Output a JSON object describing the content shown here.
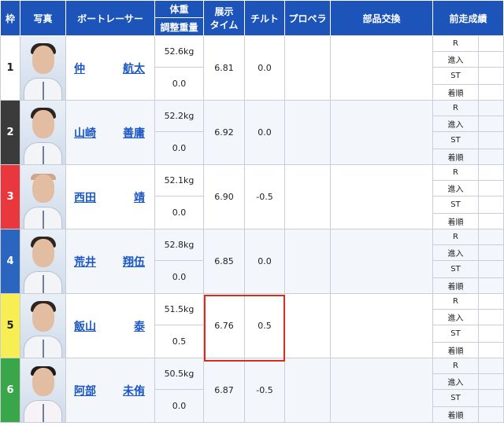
{
  "headers": {
    "lane": "枠",
    "photo": "写真",
    "racer": "ボートレーサー",
    "weight": "体重",
    "adjust_weight": "調整重量",
    "exhibit_time_line1": "展示",
    "exhibit_time_line2": "タイム",
    "tilt": "チルト",
    "propeller": "プロペラ",
    "parts": "部品交換",
    "prev_results": "前走成績"
  },
  "record_labels": [
    "R",
    "進入",
    "ST",
    "着順"
  ],
  "lane_colors": {
    "1": "#ffffff",
    "2": "#3b3b3b",
    "3": "#e8373d",
    "4": "#2a66bf",
    "5": "#f6ee53",
    "6": "#3aa64a"
  },
  "racers": [
    {
      "lane": "1",
      "surname": "仲",
      "given": "航太",
      "weight": "52.6kg",
      "adjust": "0.0",
      "exhibit_time": "6.81",
      "tilt": "0.0"
    },
    {
      "lane": "2",
      "surname": "山崎",
      "given": "善庸",
      "weight": "52.2kg",
      "adjust": "0.0",
      "exhibit_time": "6.92",
      "tilt": "0.0"
    },
    {
      "lane": "3",
      "surname": "西田",
      "given": "靖",
      "weight": "52.1kg",
      "adjust": "0.0",
      "exhibit_time": "6.90",
      "tilt": "-0.5"
    },
    {
      "lane": "4",
      "surname": "荒井",
      "given": "翔伍",
      "weight": "52.8kg",
      "adjust": "0.0",
      "exhibit_time": "6.85",
      "tilt": "0.0"
    },
    {
      "lane": "5",
      "surname": "飯山",
      "given": "泰",
      "weight": "51.5kg",
      "adjust": "0.5",
      "exhibit_time": "6.76",
      "tilt": "0.5"
    },
    {
      "lane": "6",
      "surname": "阿部",
      "given": "未侑",
      "weight": "50.5kg",
      "adjust": "0.0",
      "exhibit_time": "6.87",
      "tilt": "-0.5"
    }
  ]
}
